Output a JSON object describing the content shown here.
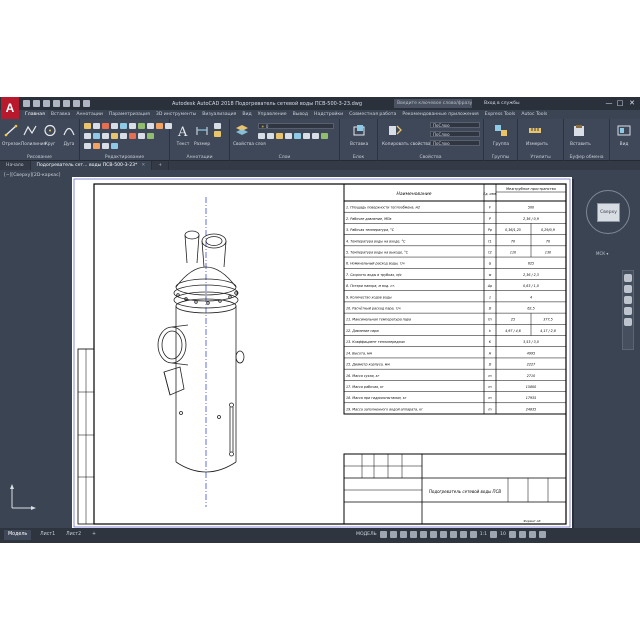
{
  "app": {
    "logo": "A",
    "window_title": "Autodesk AutoCAD 2018   Подогреватель сетевой воды ПСВ-500-3-23.dwg",
    "search_placeholder": "Введите ключевое слово/фразу",
    "signin": "Вход в службы",
    "window_controls": [
      "—",
      "□",
      "✕"
    ]
  },
  "ribbon": {
    "tabs": [
      "Главная",
      "Вставка",
      "Аннотации",
      "Параметризация",
      "3D инструменты",
      "Визуализация",
      "Вид",
      "Управление",
      "Вывод",
      "Надстройки",
      "Совместная работа",
      "Рекомендованные приложения",
      "Express Tools",
      "Autoc Tools"
    ],
    "active_tab": "Главная",
    "groups": [
      {
        "label": "Рисование",
        "tools": [
          "Отрезок",
          "Полилиния",
          "Круг",
          "Дуга"
        ]
      },
      {
        "label": "Редактирование",
        "tools": []
      },
      {
        "label": "Аннотации",
        "tools": [
          "Текст",
          "Размер"
        ]
      },
      {
        "label": "Слои",
        "tools": [
          "Свойства слоя"
        ]
      },
      {
        "label": "Блок",
        "tools": [
          "Вставка"
        ]
      },
      {
        "label": "Свойства",
        "tools": [
          "Копировать свойства"
        ]
      },
      {
        "label": "Группы",
        "tools": [
          "Группа"
        ]
      },
      {
        "label": "Утилиты",
        "tools": [
          "Измерить"
        ]
      },
      {
        "label": "Буфер обмена",
        "tools": [
          "Вставить"
        ]
      },
      {
        "label": "",
        "tools": [
          "Вид"
        ]
      }
    ],
    "layer_combo": "0",
    "prop_combos": [
      "ПоСлою",
      "ПоСлою",
      "ПоСлою"
    ]
  },
  "doc_tabs": [
    {
      "label": "Начало",
      "active": false
    },
    {
      "label": "Подогреватель сет... воды ПСВ-500-3-23*",
      "active": true
    }
  ],
  "viewport": {
    "label": "[−][Сверху][2D-каркас]",
    "viewcube_face": "Сверху",
    "ucs_label": "МСК ▾"
  },
  "drawing": {
    "table_header": {
      "param": "Наименование",
      "unit": "Ед. изм.",
      "value": "Межтрубное пространство"
    },
    "rows": [
      {
        "name": "1. Площадь поверхности теплообмена, м2",
        "unit": "F",
        "v1": "500",
        "v2": ""
      },
      {
        "name": "2. Рабочее давление, МПа",
        "unit": "P",
        "v1": "2,36 / 0,9",
        "v2": ""
      },
      {
        "name": "3. Рабочая температура, °С",
        "unit": "Pp",
        "v1": "0,36/1,25",
        "v2": "0,29/0,9"
      },
      {
        "name": "4. Температура воды на входе, °С",
        "unit": "t1",
        "v1": "70",
        "v2": "70"
      },
      {
        "name": "5. Температура воды на выходе, °С",
        "unit": "t2",
        "v1": "110",
        "v2": "130"
      },
      {
        "name": "6. Номинальный расход воды, т/ч",
        "unit": "G",
        "v1": "625",
        "v2": ""
      },
      {
        "name": "7. Скорость воды в трубках, м/с",
        "unit": "w",
        "v1": "2,36 / 2,3",
        "v2": ""
      },
      {
        "name": "8. Потери напора, м вод. ст.",
        "unit": "Δp",
        "v1": "0,63 / 1,0",
        "v2": ""
      },
      {
        "name": "9. Количество ходов воды",
        "unit": "z",
        "v1": "4",
        "v2": ""
      },
      {
        "name": "10. Расчётный расход пара, т/ч",
        "unit": "D",
        "v1": "62,5",
        "v2": ""
      },
      {
        "name": "11. Максимальная температура пара",
        "unit": "tп",
        "v1": "25",
        "v2": "377,5"
      },
      {
        "name": "12. Давление пара",
        "unit": "k",
        "v1": "4,97 / 4,6",
        "v2": "4,17 / 2,8"
      },
      {
        "name": "13. Коэффициент теплопередачи",
        "unit": "K",
        "v1": "3,53 / 3,0",
        "v2": ""
      },
      {
        "name": "14. Высота, мм",
        "unit": "H",
        "v1": "4995",
        "v2": ""
      },
      {
        "name": "15. Диаметр корпуса, мм",
        "unit": "D",
        "v1": "2227",
        "v2": ""
      },
      {
        "name": "16. Масса сухая, кг",
        "unit": "m",
        "v1": "2710",
        "v2": ""
      },
      {
        "name": "17. Масса рабочая, кг",
        "unit": "m",
        "v1": "15800",
        "v2": ""
      },
      {
        "name": "18. Масса при гидроиспытании, кг",
        "unit": "m",
        "v1": "17935",
        "v2": ""
      },
      {
        "name": "19. Масса заполненного водой аппарата, кг",
        "unit": "m",
        "v1": "24835",
        "v2": ""
      }
    ],
    "stamp_title": "Подогреватель сетевой воды ПСВ",
    "stamp_sheet": "Формат А3"
  },
  "layout_tabs": [
    {
      "label": "Модель",
      "active": true
    },
    {
      "label": "Лист1",
      "active": false
    },
    {
      "label": "Лист2",
      "active": false
    },
    {
      "label": "+",
      "active": false
    }
  ],
  "status": {
    "model": "МОДЕЛЬ",
    "scale": "1:1",
    "extra": "10"
  }
}
